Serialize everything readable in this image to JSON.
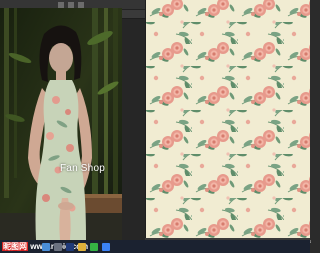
{
  "photo": {
    "watermark_text": "Fan Shop"
  },
  "footer": {
    "site_logo_cn": "昵图网",
    "site_logo_url": "www.nipic.com",
    "image_id": "ID:27075971 NO:20200701122753234084"
  },
  "taskbar": {
    "icons": [
      "windows-start-icon",
      "search-icon",
      "photoshop-icon",
      "file-explorer-icon",
      "wechat-icon",
      "app-icon"
    ]
  },
  "colors": {
    "pattern_background": "#f1ecd2",
    "rose": "#e79a8c",
    "leaf": "#6f9a78",
    "dress": "#c7d3b8"
  }
}
